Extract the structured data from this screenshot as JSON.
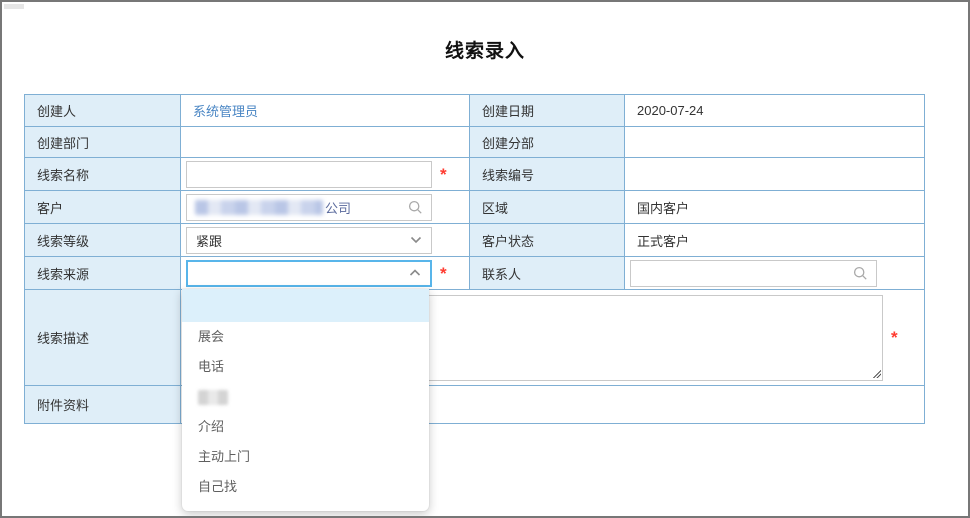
{
  "window": {
    "title": "线索录入"
  },
  "colors": {
    "table_border": "#7fafd4",
    "label_bg": "#dfeef8",
    "focus_border": "#58b5ea",
    "required": "#ff3b30",
    "link": "#4a86c4",
    "dropdown_highlight": "#dcf0fb"
  },
  "form": {
    "creator": {
      "label": "创建人",
      "value": "系统管理员"
    },
    "create_date": {
      "label": "创建日期",
      "value": "2020-07-24"
    },
    "create_dept": {
      "label": "创建部门",
      "value": ""
    },
    "create_branch": {
      "label": "创建分部",
      "value": ""
    },
    "lead_name": {
      "label": "线索名称",
      "value": "",
      "required_mark": "*"
    },
    "lead_no": {
      "label": "线索编号",
      "value": ""
    },
    "customer": {
      "label": "客户",
      "value_redacted": true,
      "value_suffix": "公司"
    },
    "region": {
      "label": "区域",
      "value": "国内客户"
    },
    "lead_level": {
      "label": "线索等级",
      "value": "紧跟"
    },
    "customer_status": {
      "label": "客户状态",
      "value": "正式客户"
    },
    "lead_source": {
      "label": "线索来源",
      "value": "",
      "required_mark": "*"
    },
    "contact": {
      "label": "联系人",
      "value": ""
    },
    "lead_desc": {
      "label": "线索描述",
      "value": "",
      "required_mark": "*"
    },
    "attachment": {
      "label": "附件资料",
      "value": ""
    }
  },
  "lead_source_dropdown": {
    "options": [
      {
        "text": "",
        "state": "highlighted"
      },
      {
        "text": "展会"
      },
      {
        "text": "电话"
      },
      {
        "text": "",
        "redacted": true
      },
      {
        "text": "介绍"
      },
      {
        "text": "主动上门"
      },
      {
        "text": "自己找"
      }
    ]
  }
}
